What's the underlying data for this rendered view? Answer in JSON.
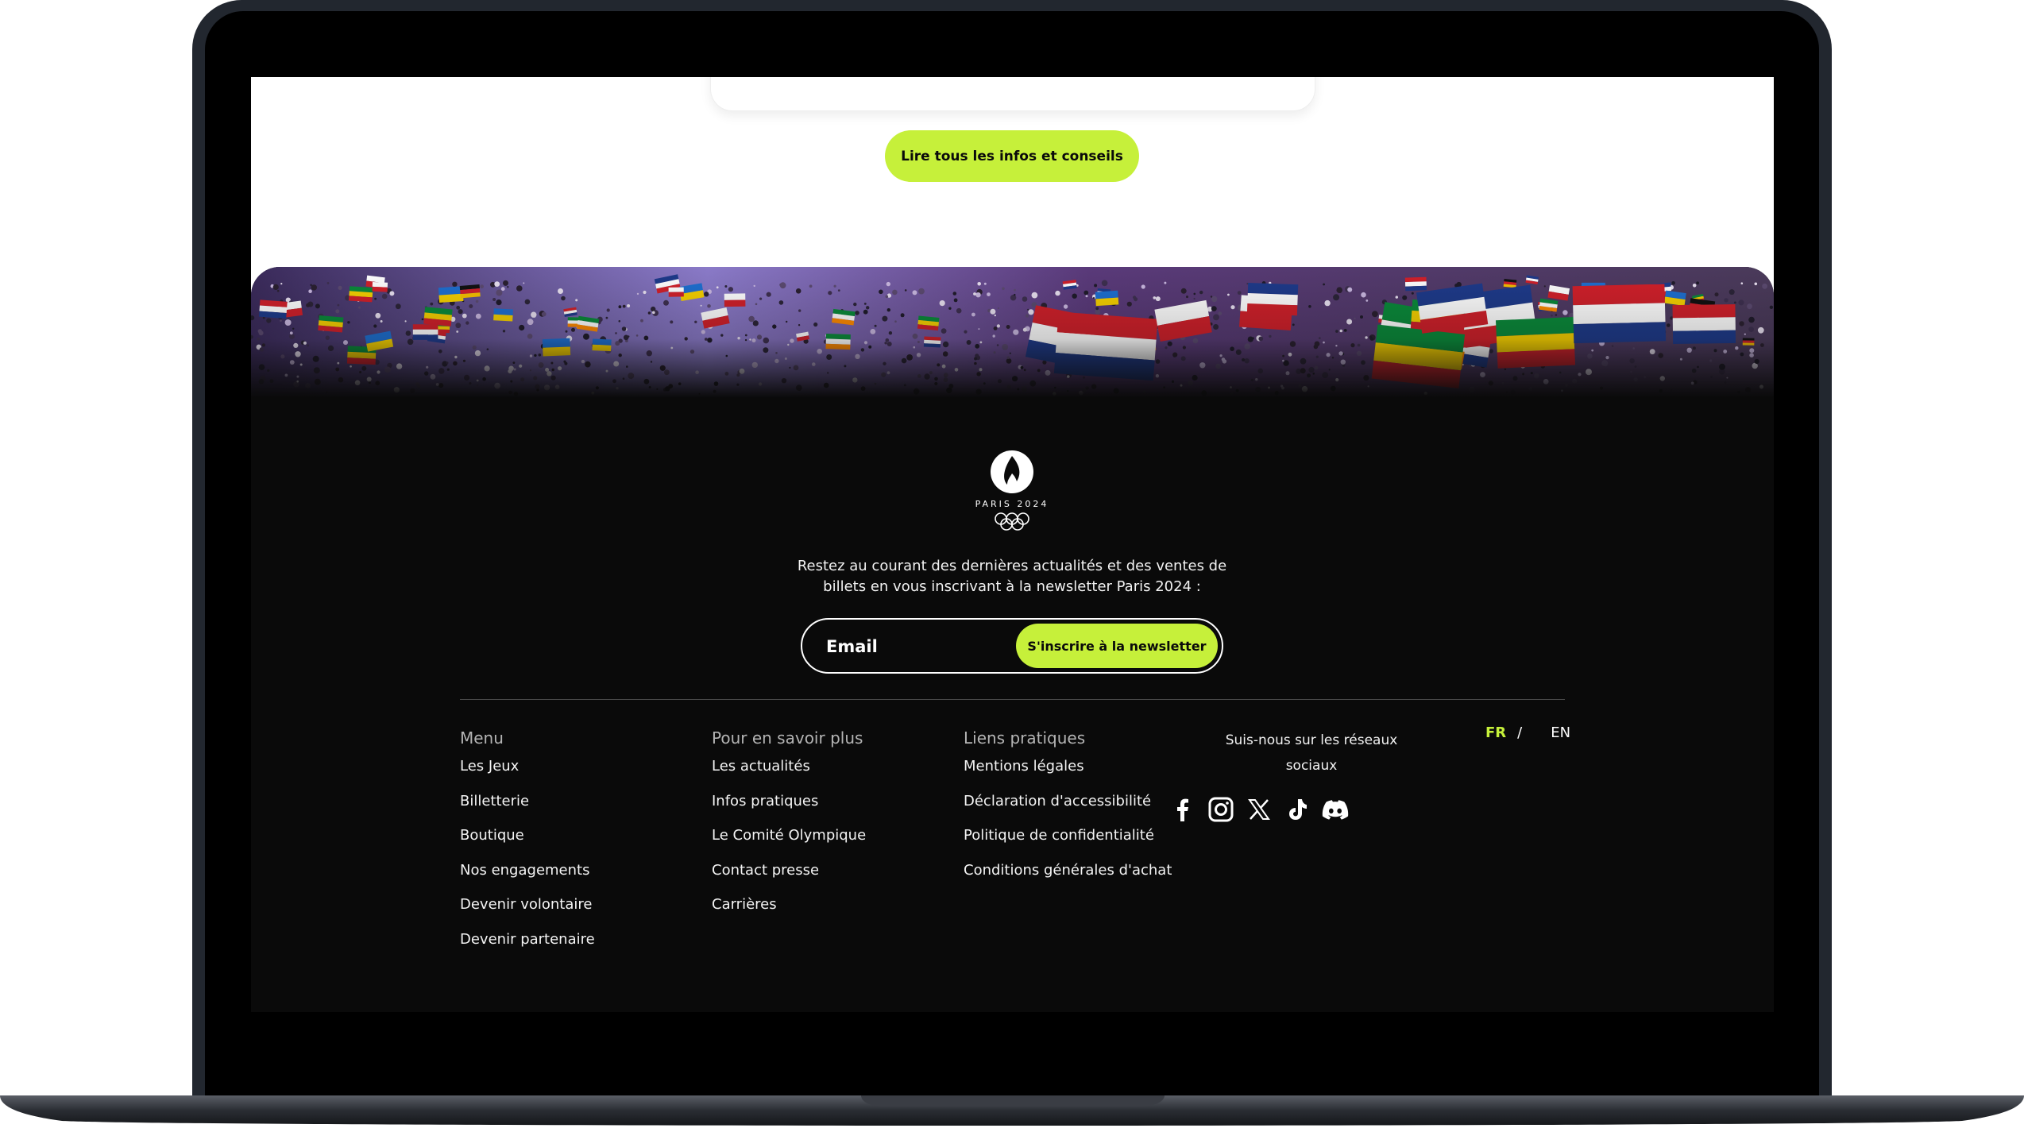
{
  "main": {
    "cta_label": "Lire tous les infos et conseils"
  },
  "footer": {
    "logo": {
      "text": "PARIS 2024",
      "icon": "paris-2024-flame-logo"
    },
    "newsletter": {
      "text": "Restez au courant des dernières actualités et des ventes de billets en vous inscrivant à la newsletter Paris 2024 :",
      "email_placeholder": "Email",
      "subscribe_label": "S'inscrire à la newsletter"
    },
    "columns": [
      {
        "title": "Menu",
        "links": [
          "Les Jeux",
          "Billetterie",
          "Boutique",
          "Nos engagements",
          "Devenir volontaire",
          "Devenir partenaire"
        ]
      },
      {
        "title": "Pour en savoir plus",
        "links": [
          "Les actualités",
          "Infos pratiques",
          "Le Comité Olympique",
          "Contact presse",
          "Carrières"
        ]
      },
      {
        "title": "Liens pratiques",
        "links": [
          "Mentions légales",
          "Déclaration d'accessibilité",
          "Politique de confidentialité",
          "Conditions générales d'achat"
        ]
      }
    ],
    "social": {
      "title": "Suis-nous sur les réseaux sociaux",
      "icons": [
        "facebook-icon",
        "instagram-icon",
        "x-icon",
        "tiktok-icon",
        "discord-icon"
      ]
    },
    "language": {
      "fr": "FR",
      "separator": "/",
      "en": "EN"
    }
  },
  "colors": {
    "accent": "#c6f03a",
    "footer_bg": "#0a0a0a",
    "laptop_frame": "#22272f"
  }
}
